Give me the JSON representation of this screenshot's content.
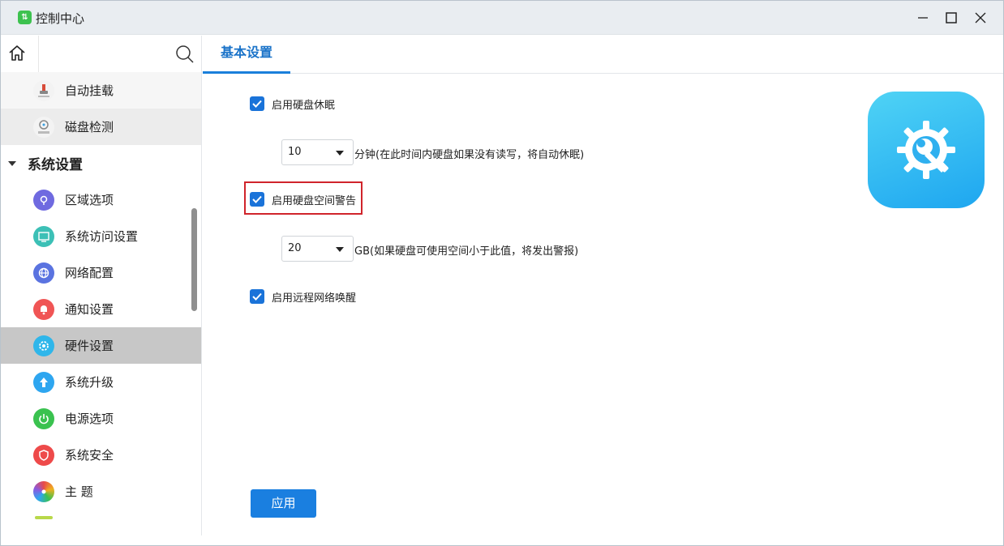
{
  "window": {
    "title": "控制中心"
  },
  "sidebar": {
    "items_top": [
      {
        "label": "自动挂载",
        "icon": "usb-mount-icon"
      },
      {
        "label": "磁盘检测",
        "icon": "disk-check-icon"
      }
    ],
    "group": {
      "label": "系统设置"
    },
    "items": [
      {
        "label": "区域选项",
        "icon": "region-icon",
        "color": "#6f6ae0"
      },
      {
        "label": "系统访问设置",
        "icon": "monitor-icon",
        "color": "#3cc0b6"
      },
      {
        "label": "网络配置",
        "icon": "network-icon",
        "color": "#5a73e0"
      },
      {
        "label": "通知设置",
        "icon": "bell-icon",
        "color": "#f05555"
      },
      {
        "label": "硬件设置",
        "icon": "hardware-icon",
        "color": "#2fb6ea"
      },
      {
        "label": "系统升级",
        "icon": "upgrade-icon",
        "color": "#2ea6f0"
      },
      {
        "label": "电源选项",
        "icon": "power-icon",
        "color": "#3ac24f"
      },
      {
        "label": "系统安全",
        "icon": "shield-icon",
        "color": "#ee4a4a"
      },
      {
        "label": "主 题",
        "icon": "theme-icon",
        "color": "#e8a020"
      }
    ]
  },
  "main": {
    "tab": "基本设置",
    "hibernate": {
      "label": "启用硬盘休眠",
      "value": "10",
      "hint": "分钟(在此时间内硬盘如果没有读写，将自动休眠)"
    },
    "space_warning": {
      "label": "启用硬盘空间警告",
      "value": "20",
      "hint": "GB(如果硬盘可使用空间小于此值，将发出警报)"
    },
    "wol": {
      "label": "启用远程网络唤醒"
    },
    "apply_label": "应用"
  }
}
